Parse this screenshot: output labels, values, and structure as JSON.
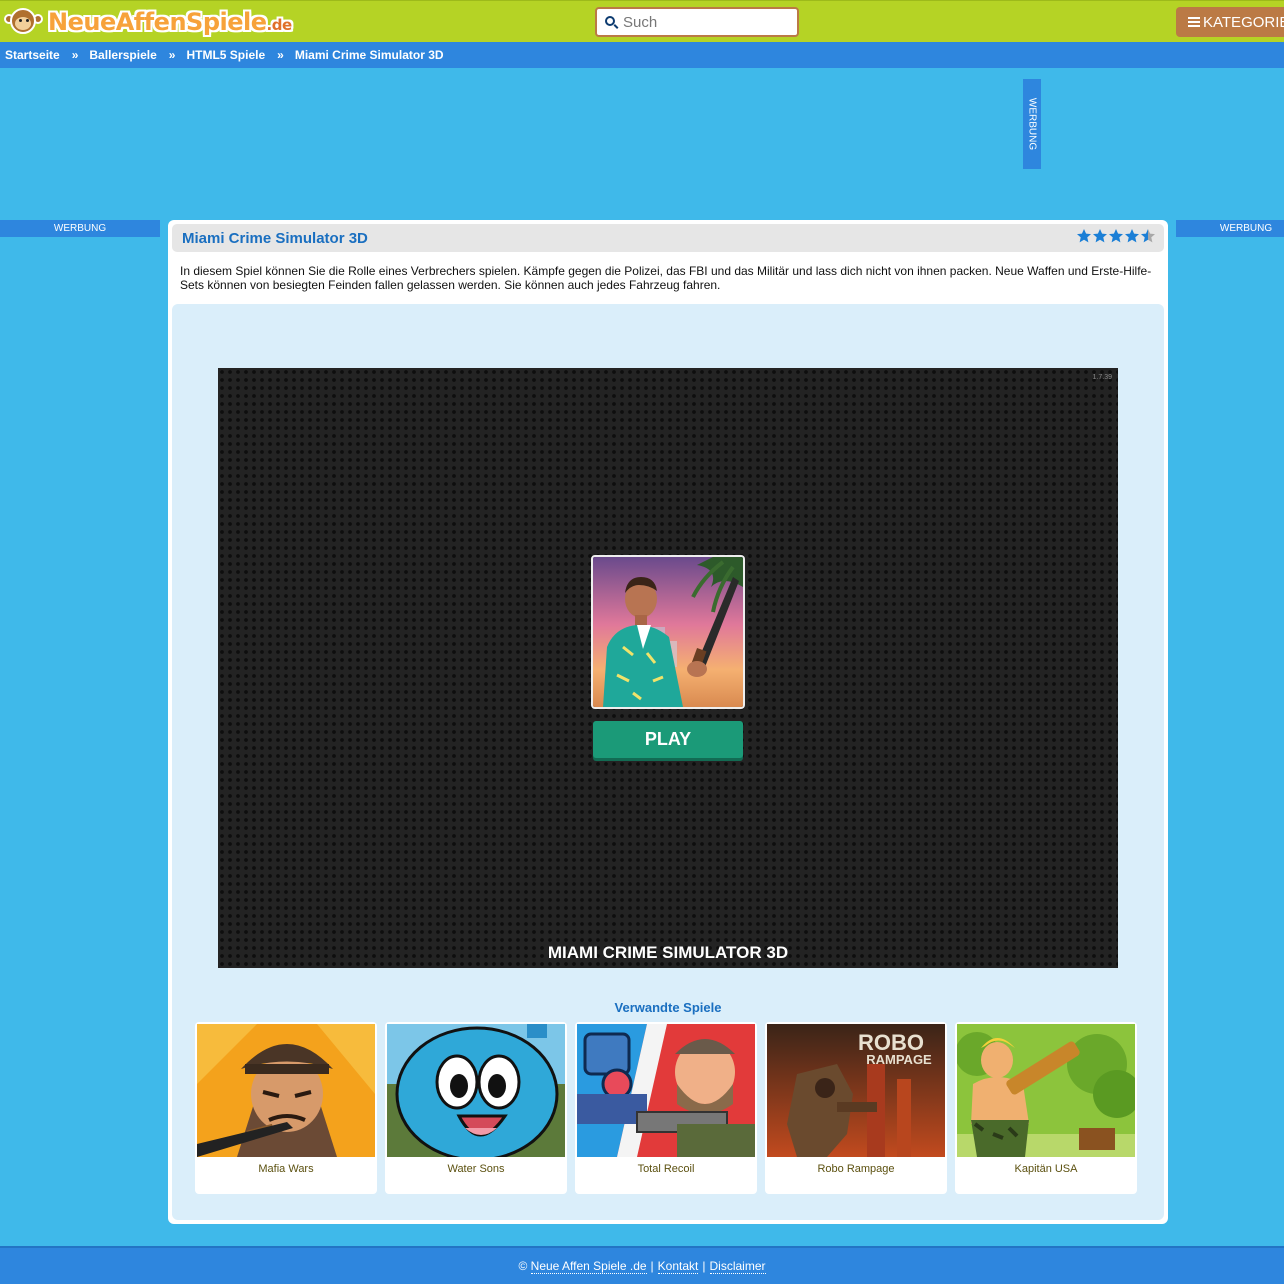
{
  "header": {
    "logo_main": "NeueAffenSpiele",
    "logo_tld": ".de",
    "search_placeholder": "Such",
    "categories_label": "KATEGORIEN"
  },
  "breadcrumb": {
    "items": [
      "Startseite",
      "Ballerspiele",
      "HTML5 Spiele",
      "Miami Crime Simulator 3D"
    ],
    "separator": "»"
  },
  "ads": {
    "label": "WERBUNG"
  },
  "game": {
    "title": "Miami Crime Simulator 3D",
    "rating": 4.5,
    "rating_max": 5,
    "description": "In diesem Spiel können Sie die Rolle eines Verbrechers spielen. Kämpfe gegen die Polizei, das FBI und das Militär und lass dich nicht von ihnen packen. Neue Waffen und Erste-Hilfe-Sets können von besiegten Feinden fallen gelassen werden. Sie können auch jedes Fahrzeug fahren.",
    "version": "1.7.39",
    "play_label": "PLAY",
    "canvas_title": "MIAMI CRIME SIMULATOR 3D"
  },
  "related": {
    "heading": "Verwandte Spiele",
    "games": [
      {
        "name": "Mafia Wars"
      },
      {
        "name": "Water Sons"
      },
      {
        "name": "Total Recoil"
      },
      {
        "name": "Robo Rampage",
        "art_text": "ROBO RAMPAGE"
      },
      {
        "name": "Kapitän USA"
      }
    ]
  },
  "footer": {
    "copyright": "©",
    "site_link": "Neue Affen Spiele .de",
    "contact_link": "Kontakt",
    "disclaimer_link": "Disclaimer",
    "separator": "|"
  },
  "colors": {
    "header_green": "#b5d325",
    "nav_blue": "#2e86de",
    "page_blue": "#3fb9ea",
    "accent_brown": "#bb7a45",
    "play_green": "#1b9a78",
    "title_blue": "#1a6fc0"
  }
}
